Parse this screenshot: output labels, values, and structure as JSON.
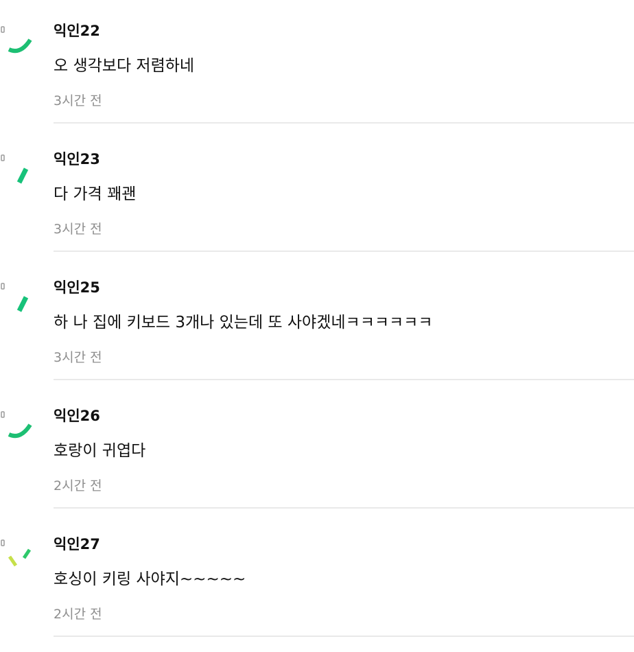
{
  "comments": [
    {
      "author": "익인22",
      "content": "오 생각보다 저렴하네",
      "time": "3시간 전",
      "avatar_icon": "arc-avatar-icon",
      "avatar_color": "#1dbf73"
    },
    {
      "author": "익인23",
      "content": "다 가격 꽤괜",
      "time": "3시간 전",
      "avatar_icon": "dash-avatar-icon",
      "avatar_color": "#17c27a"
    },
    {
      "author": "익인25",
      "content": "하 나 집에 키보드 3개나 있는데 또 사야겠네ㅋㅋㅋㅋㅋㅋ",
      "time": "3시간 전",
      "avatar_icon": "dash-avatar-icon",
      "avatar_color": "#17c27a"
    },
    {
      "author": "익인26",
      "content": "호랑이 귀엽다",
      "time": "2시간 전",
      "avatar_icon": "arc-avatar-icon",
      "avatar_color": "#1dbf73"
    },
    {
      "author": "익인27",
      "content": "호싱이 키링 사야지~~~~~",
      "time": "2시간 전",
      "avatar_icon": "double-dash-avatar-icon",
      "avatar_color": "#c6e04a"
    }
  ],
  "colors": {
    "author": "#111111",
    "content": "#111111",
    "time": "#8e8e8e",
    "divider": "#e9e9e9",
    "avatar_dot": "#9a9a9a"
  }
}
